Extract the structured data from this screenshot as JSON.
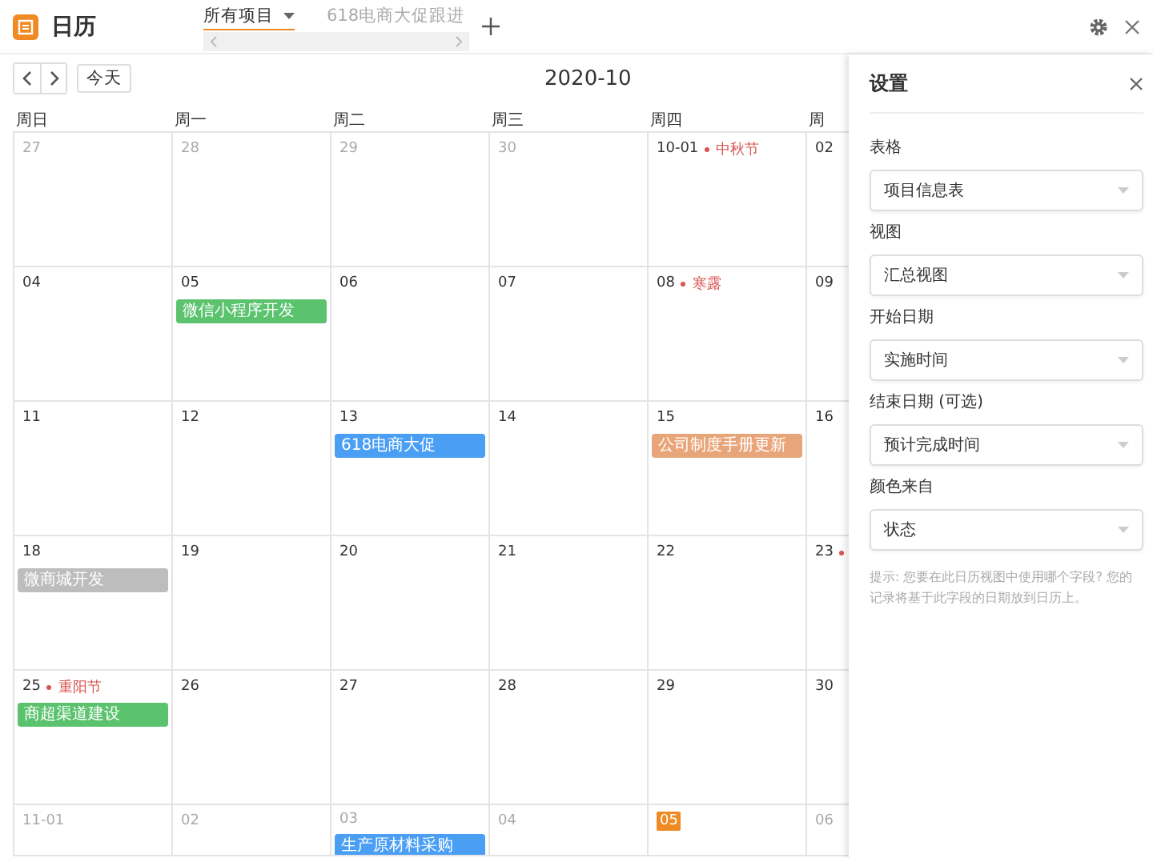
{
  "app": {
    "title": "日历"
  },
  "tabs": [
    {
      "label": "所有项目",
      "selected": true,
      "dropdown": true
    },
    {
      "label": "618电商大促跟进",
      "selected": false,
      "dropdown": false
    }
  ],
  "calendar": {
    "today_button": "今天",
    "month": "2020-10",
    "weekdays": [
      "周日",
      "周一",
      "周二",
      "周三",
      "周四",
      "周"
    ],
    "weeks": [
      [
        {
          "day": "27",
          "muted": true
        },
        {
          "day": "28",
          "muted": true
        },
        {
          "day": "29",
          "muted": true
        },
        {
          "day": "30",
          "muted": true
        },
        {
          "day": "10-01",
          "muted": false,
          "holiday": "中秋节"
        },
        {
          "day": "02",
          "muted": false
        }
      ],
      [
        {
          "day": "04",
          "muted": false
        },
        {
          "day": "05",
          "muted": false,
          "events": [
            {
              "title": "微信小程序开发",
              "color": "#5bc26e"
            }
          ]
        },
        {
          "day": "06",
          "muted": false
        },
        {
          "day": "07",
          "muted": false
        },
        {
          "day": "08",
          "muted": false,
          "holiday": "寒露"
        },
        {
          "day": "09",
          "muted": false
        }
      ],
      [
        {
          "day": "11",
          "muted": false
        },
        {
          "day": "12",
          "muted": false
        },
        {
          "day": "13",
          "muted": false,
          "events": [
            {
              "title": "618电商大促",
              "color": "#4a9ff5"
            }
          ]
        },
        {
          "day": "14",
          "muted": false
        },
        {
          "day": "15",
          "muted": false,
          "events": [
            {
              "title": "公司制度手册更新",
              "color": "#e9a57a"
            }
          ]
        },
        {
          "day": "16",
          "muted": false
        }
      ],
      [
        {
          "day": "18",
          "muted": false,
          "events": [
            {
              "title": "微商城开发",
              "color": "#bdbdbd"
            }
          ]
        },
        {
          "day": "19",
          "muted": false
        },
        {
          "day": "20",
          "muted": false
        },
        {
          "day": "21",
          "muted": false
        },
        {
          "day": "22",
          "muted": false
        },
        {
          "day": "23",
          "muted": false,
          "holiday_dot": true
        }
      ],
      [
        {
          "day": "25",
          "muted": false,
          "holiday": "重阳节",
          "events": [
            {
              "title": "商超渠道建设",
              "color": "#5bc26e"
            }
          ]
        },
        {
          "day": "26",
          "muted": false
        },
        {
          "day": "27",
          "muted": false
        },
        {
          "day": "28",
          "muted": false
        },
        {
          "day": "29",
          "muted": false
        },
        {
          "day": "30",
          "muted": false
        }
      ],
      [
        {
          "day": "11-01",
          "muted": true
        },
        {
          "day": "02",
          "muted": true
        },
        {
          "day": "03",
          "muted": true,
          "events": [
            {
              "title": "生产原材料采购",
              "color": "#4a9ff5"
            }
          ]
        },
        {
          "day": "04",
          "muted": true
        },
        {
          "day": "05",
          "muted": true,
          "today": true
        },
        {
          "day": "06",
          "muted": true
        }
      ]
    ]
  },
  "settings": {
    "title": "设置",
    "fields": [
      {
        "label": "表格",
        "value": "项目信息表"
      },
      {
        "label": "视图",
        "value": "汇总视图"
      },
      {
        "label": "开始日期",
        "value": "实施时间"
      },
      {
        "label": "结束日期 (可选)",
        "value": "预计完成时间"
      },
      {
        "label": "颜色来自",
        "value": "状态"
      }
    ],
    "hint": "提示: 您要在此日历视图中使用哪个字段? 您的记录将基于此字段的日期放到日历上。"
  }
}
